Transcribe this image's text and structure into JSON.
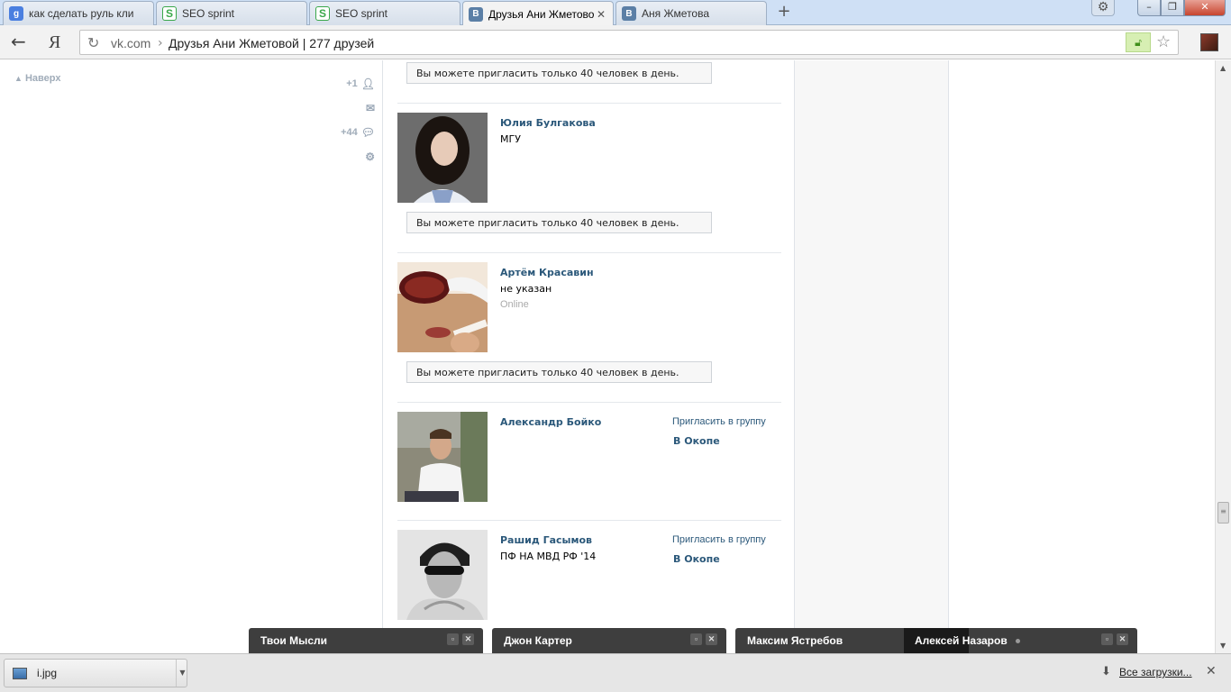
{
  "tabs": [
    {
      "title": "как сделать руль кли",
      "icon": "google-icon",
      "active": false
    },
    {
      "title": "SEO sprint",
      "icon": "seosprint-icon",
      "active": false
    },
    {
      "title": "SEO sprint",
      "icon": "seosprint-icon",
      "active": false
    },
    {
      "title": "Друзья Ани Жметово",
      "icon": "vk-icon",
      "active": true
    },
    {
      "title": "Аня Жметова",
      "icon": "vk-icon",
      "active": false
    }
  ],
  "browser": {
    "back_glyph": "←",
    "yandex_glyph": "Я",
    "address_domain": "vk.com",
    "address_separator": "›",
    "address_title": "Друзья Ани Жметовой | 277 друзей",
    "newtab_glyph": "+",
    "favicon_g": "g",
    "favicon_s": "S",
    "favicon_vk": "B"
  },
  "sidebar": {
    "naverh": "Наверх",
    "badges": [
      {
        "label": "+1",
        "icon": "person-icon"
      },
      {
        "label": "",
        "icon": "mail-icon"
      },
      {
        "label": "+44",
        "icon": "speech-bubble-icon"
      },
      {
        "label": "",
        "icon": "gear-icon"
      }
    ]
  },
  "notice_text": "Вы можете пригласить только 40 человек в день.",
  "friends": [
    {
      "name": "Юлия Булгакова",
      "info": "МГУ",
      "online": "",
      "invite": "",
      "group": ""
    },
    {
      "name": "Артём Красавин",
      "info": "не указан",
      "online": "Online",
      "invite": "",
      "group": ""
    },
    {
      "name": "Александр Бойко",
      "info": "",
      "online": "",
      "invite": "Пригласить в группу",
      "group": "В Окопе"
    },
    {
      "name": "Рашид Гасымов",
      "info": "ПФ НА МВД РФ '14",
      "online": "",
      "invite": "Пригласить в группу",
      "group": "В Окопе"
    }
  ],
  "chats": [
    {
      "name": "Твои Мысли"
    },
    {
      "name": "Джон Картер"
    },
    {
      "name": "Максим Ястребов"
    },
    {
      "name": "Алексей Назаров"
    }
  ],
  "downloads": {
    "file_name": "i.jpg",
    "all_downloads": "Все загрузки..."
  }
}
